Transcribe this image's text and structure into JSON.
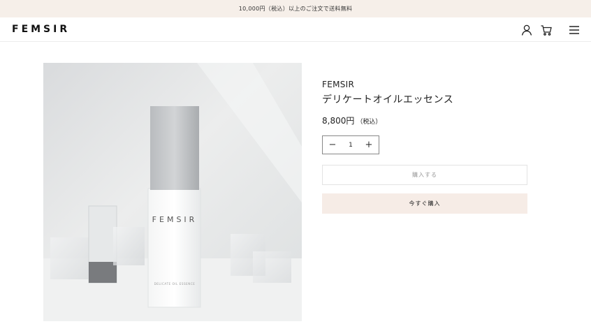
{
  "announcement": "10,000円（税込）以上のご注文で送料無料",
  "header": {
    "logo": "FEMSIR",
    "icons": [
      "user-icon",
      "cart-icon",
      "menu-icon"
    ]
  },
  "product": {
    "image_alt_bottle_text": "FEMSIR",
    "image_bottle_small_text": "DELICATE OIL ESSENCE",
    "vendor": "FEMSIR",
    "title": "デリケートオイルエッセンス",
    "price": "8,800円",
    "tax_label": "（税込）",
    "quantity": "1",
    "minus_symbol": "−",
    "plus_symbol": "+",
    "add_to_cart_label": "購入する",
    "buy_now_label": "今すぐ購入"
  },
  "colors": {
    "announcement_bg": "#f6efe9",
    "buy_now_bg": "#f6ece6"
  }
}
